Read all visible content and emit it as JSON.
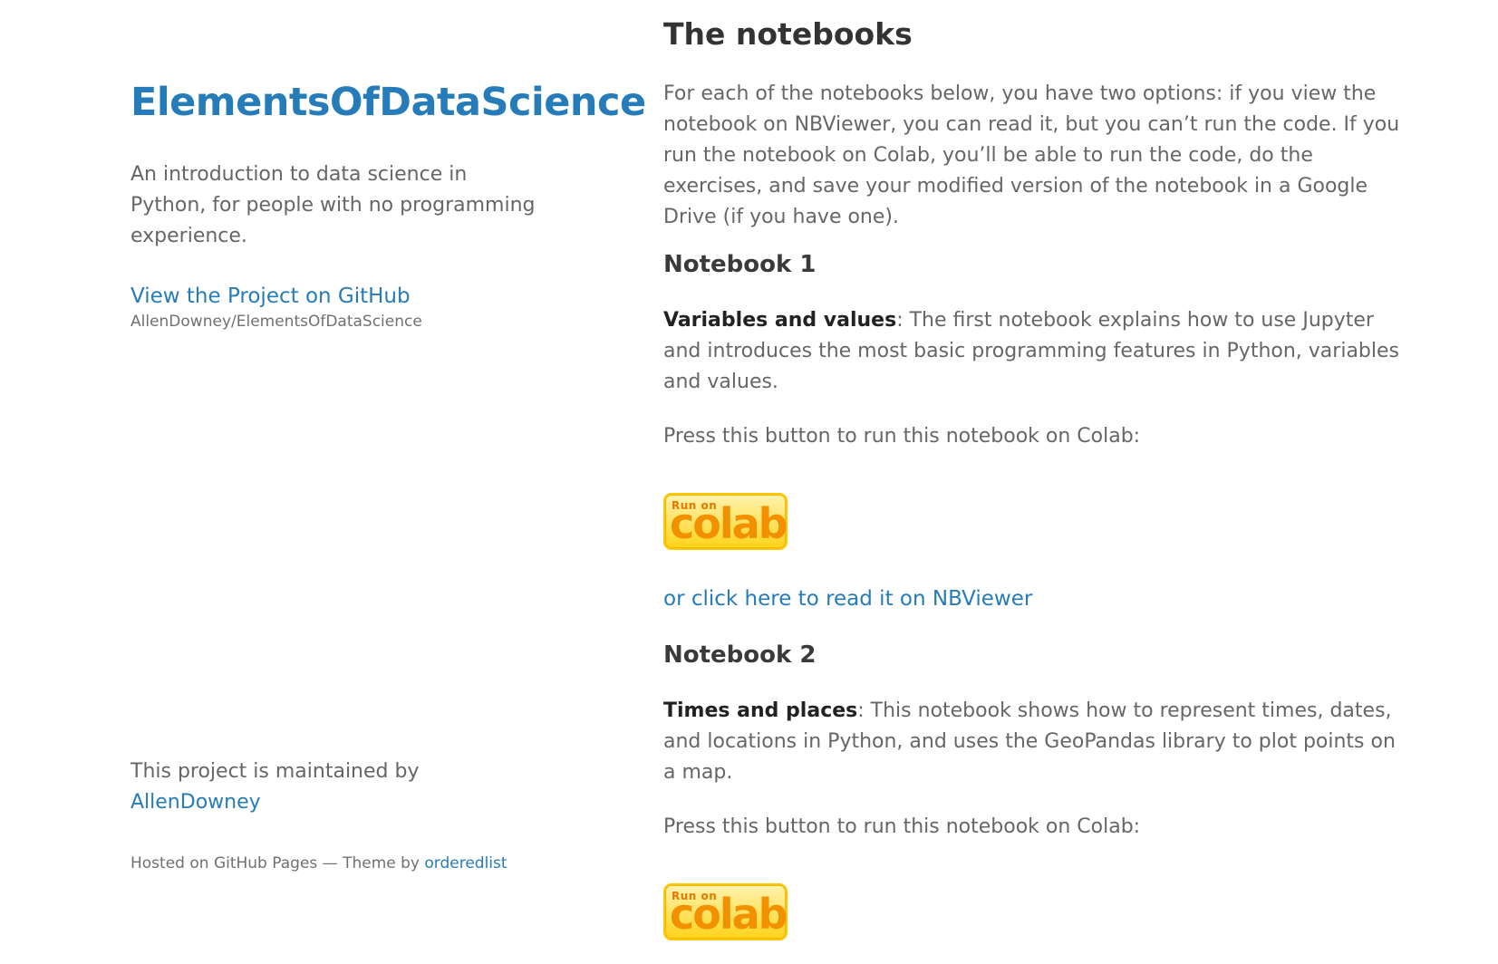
{
  "sidebar": {
    "title": "ElementsOfDataScience",
    "tagline": "An introduction to data science in Python, for people with no programming experience.",
    "github_link_label": "View the Project on GitHub",
    "github_repo": "AllenDowney/ElementsOfDataScience",
    "maintained_text": "This project is maintained by",
    "maintainer": "AllenDowney",
    "hosted_text": "Hosted on GitHub Pages — Theme by",
    "theme_author": "orderedlist"
  },
  "main": {
    "heading": "The notebooks",
    "intro": "For each of the notebooks below, you have two options: if you view the notebook on NBViewer, you can read it, but you can’t run the code. If you run the notebook on Colab, you’ll be able to run the code, do the exercises, and save your modified version of the notebook in a Google Drive (if you have one).",
    "notebooks": [
      {
        "heading": "Notebook 1",
        "title": "Variables and values",
        "description": ": The first notebook explains how to use Jupyter and introduces the most basic programming features in Python, variables and values.",
        "press_text": "Press this button to run this notebook on Colab:",
        "badge_small": "Run on",
        "badge_big": "colab",
        "nbviewer_link": "or click here to read it on NBViewer"
      },
      {
        "heading": "Notebook 2",
        "title": "Times and places",
        "description": ": This notebook shows how to represent times, dates, and locations in Python, and uses the GeoPandas library to plot points on a map.",
        "press_text": "Press this button to run this notebook on Colab:",
        "badge_small": "Run on",
        "badge_big": "colab"
      }
    ]
  },
  "colors": {
    "link": "#267CB9",
    "body_text": "#666666",
    "badge_orange": "#F29100",
    "badge_yellow": "#FFD31A"
  }
}
